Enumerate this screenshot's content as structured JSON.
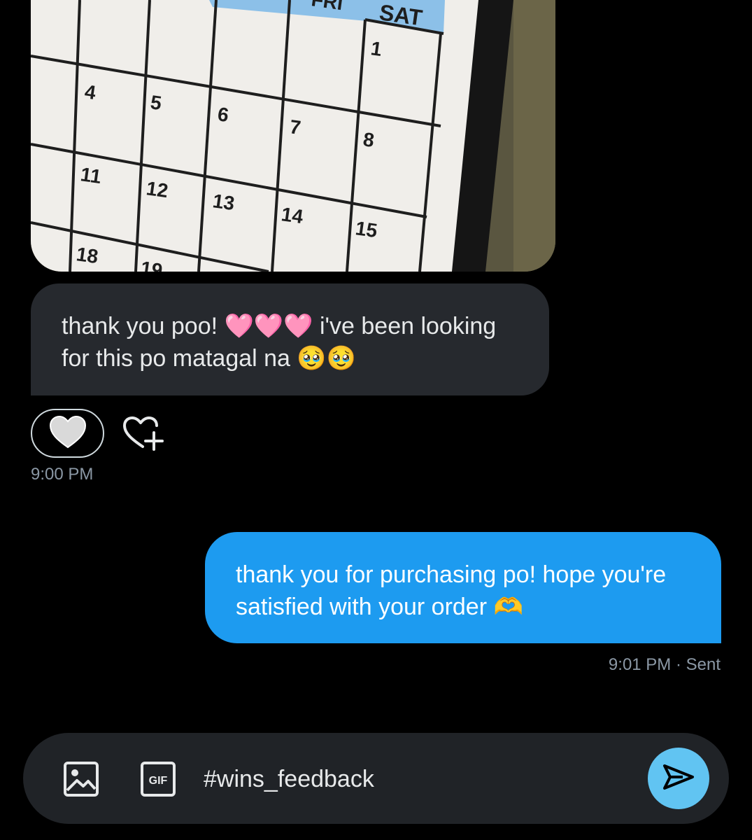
{
  "conversation": {
    "photo": {
      "alt": "calendar photo",
      "day_headers": [
        "FRI",
        "SAT"
      ],
      "day_numbers": [
        "1",
        "4",
        "5",
        "6",
        "7",
        "8",
        "11",
        "12",
        "13",
        "14",
        "15",
        "18",
        "19"
      ]
    },
    "incoming": {
      "text_part1": "thank you poo! ",
      "hearts": "🩷🩷🩷",
      "text_part2": " i've been looking for this po matagal na ",
      "emoji": "🥹🥹",
      "reaction": "🤍",
      "time": "9:00 PM"
    },
    "outgoing": {
      "text": "thank you for purchasing po! hope you're satisfied with your order ",
      "emoji": "🫶",
      "status": "9:01 PM · Sent"
    }
  },
  "composer": {
    "value": "#wins_feedback",
    "gif_label": "GIF",
    "icons": [
      "image-icon",
      "gif-icon",
      "send-icon"
    ]
  },
  "colors": {
    "background": "#000000",
    "incoming_bubble": "#26292e",
    "outgoing_bubble": "#1d9bf0",
    "composer": "#202327",
    "send_button": "#61c4f2"
  }
}
